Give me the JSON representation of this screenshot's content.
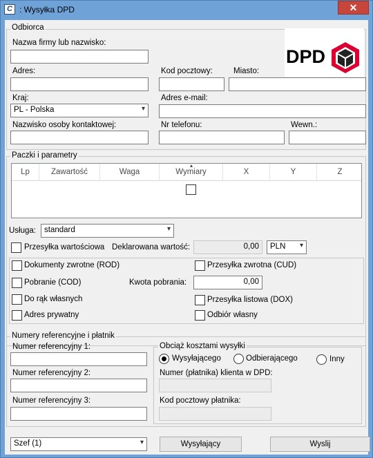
{
  "window": {
    "title": ": Wysyłka DPD",
    "close": "✕",
    "icon": "app-logo-icon"
  },
  "recipient": {
    "group_label": "Odbiorca",
    "company_label": "Nazwa firmy lub nazwisko:",
    "company_value": "",
    "address_label": "Adres:",
    "address_value": "",
    "postal_label": "Kod pocztowy:",
    "postal_value": "",
    "city_label": "Miasto:",
    "city_value": "",
    "country_label": "Kraj:",
    "country_value": "PL - Polska",
    "email_label": "Adres e-mail:",
    "email_value": "",
    "contact_label": "Nazwisko osoby kontaktowej:",
    "contact_value": "",
    "phone_label": "Nr telefonu:",
    "phone_value": "",
    "ext_label": "Wewn.:",
    "ext_value": ""
  },
  "logo": {
    "text": "DPD",
    "color": "#dc0032"
  },
  "parcels": {
    "group_label": "Paczki i parametry",
    "columns": [
      "Lp",
      "Zawartość",
      "Waga",
      "Wymiary",
      "X",
      "Y",
      "Z"
    ],
    "service_label": "Usługa:",
    "service_value": "standard",
    "declared_checkbox_label": "Przesyłka wartościowa",
    "declared_value_label": "Deklarowana wartość:",
    "declared_value": "0,00",
    "currency": "PLN",
    "options": {
      "rod": "Dokumenty zwrotne (ROD)",
      "cud": "Przesyłka zwrotna (CUD)",
      "cod": "Pobranie (COD)",
      "cod_amount_label": "Kwota pobrania:",
      "cod_amount": "0,00",
      "own_hands": "Do rąk własnych",
      "dox": "Przesyłka listowa (DOX)",
      "private": "Adres prywatny",
      "self_pickup": "Odbiór własny"
    }
  },
  "references": {
    "group_label": "Numery referencyjne i płatnik",
    "ref1_label": "Numer referencyjny 1:",
    "ref1_value": "",
    "ref2_label": "Numer referencyjny 2:",
    "ref2_value": "",
    "ref3_label": "Numer referencyjny 3:",
    "ref3_value": "",
    "charge_group_label": "Obciąż kosztami wysyłki",
    "payer_options": [
      "Wysyłającego",
      "Odbierającego",
      "Inny"
    ],
    "payer_selected": "Wysyłającego",
    "payer_number_label": "Numer (płatnika) klienta w DPD:",
    "payer_number_value": "",
    "payer_postal_label": "Kod pocztowy płatnika:",
    "payer_postal_value": ""
  },
  "footer": {
    "sender_select": "Szef  (1)",
    "sender_button": "Wysyłający",
    "send_button": "Wyslij"
  }
}
